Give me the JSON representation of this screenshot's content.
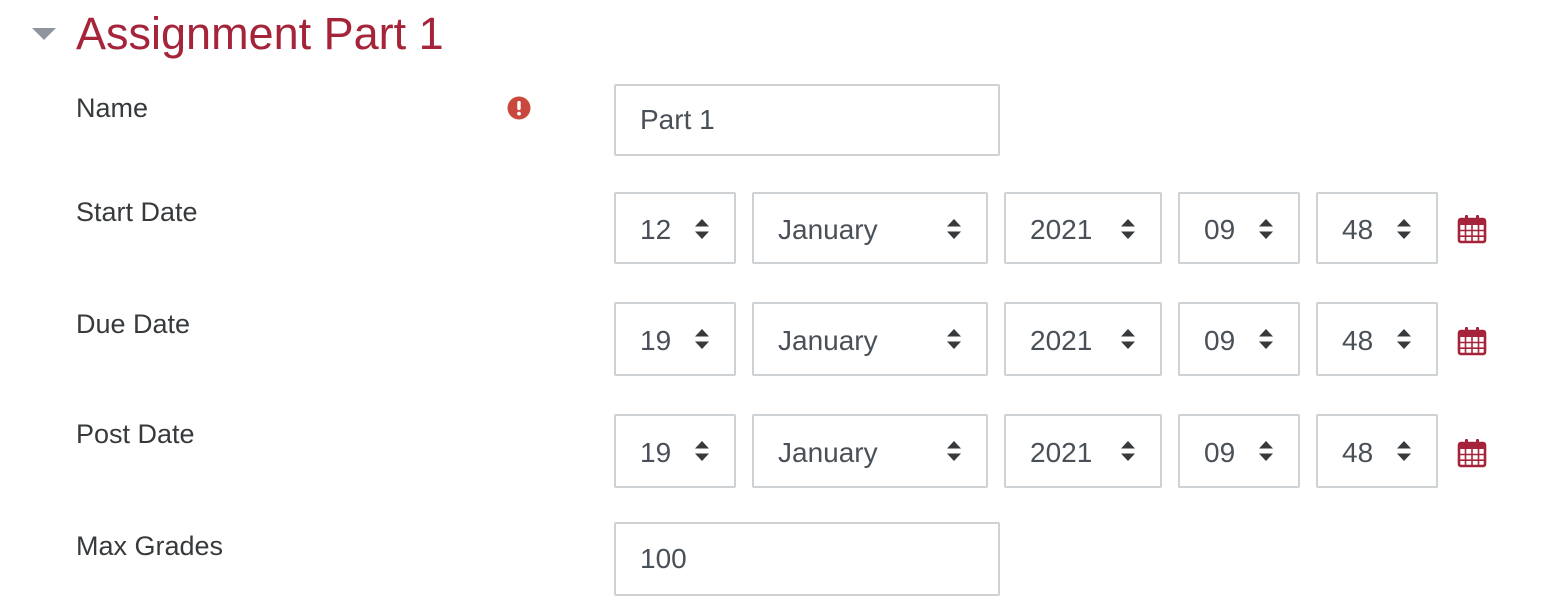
{
  "section": {
    "title": "Assignment Part 1",
    "toggle_icon": "caret-down-icon"
  },
  "colors": {
    "accent": "#a6243a",
    "required": "#c9483d",
    "border": "#cfd2d5",
    "text": "#373a3c",
    "input_text": "#495057",
    "toggle": "#8f959e"
  },
  "fields": {
    "name": {
      "label": "Name",
      "value": "Part 1",
      "required_icon": "exclamation-circle-icon"
    },
    "start_date": {
      "label": "Start Date",
      "day": "12",
      "month": "January",
      "year": "2021",
      "hour": "09",
      "minute": "48",
      "calendar_icon": "calendar-icon"
    },
    "due_date": {
      "label": "Due Date",
      "day": "19",
      "month": "January",
      "year": "2021",
      "hour": "09",
      "minute": "48",
      "calendar_icon": "calendar-icon"
    },
    "post_date": {
      "label": "Post Date",
      "day": "19",
      "month": "January",
      "year": "2021",
      "hour": "09",
      "minute": "48",
      "calendar_icon": "calendar-icon"
    },
    "max_grades": {
      "label": "Max Grades",
      "value": "100"
    }
  }
}
